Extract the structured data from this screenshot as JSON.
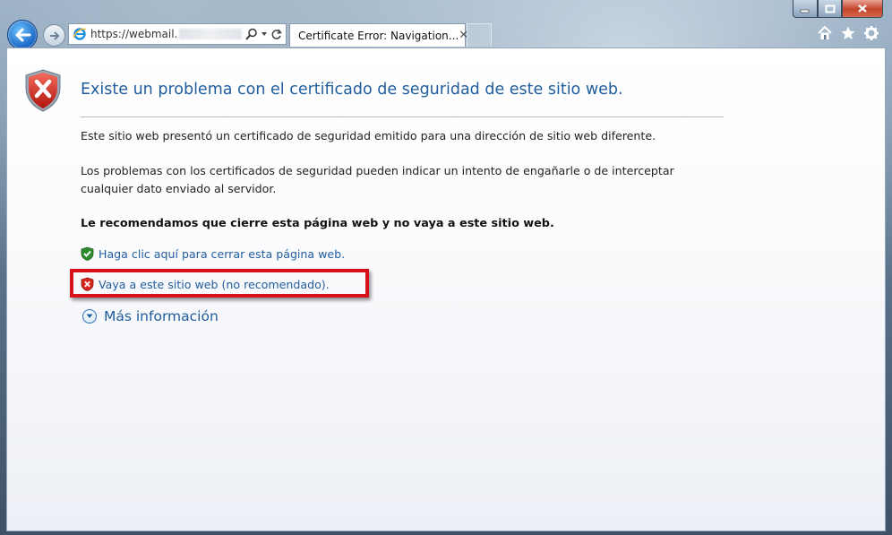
{
  "browser": {
    "address_url": "https://webmail.",
    "tab_title": "Certificate Error: Navigation...",
    "tab_close": "✕"
  },
  "icons": {
    "back": "back-arrow-icon",
    "forward": "forward-arrow-icon",
    "ie": "internet-explorer-icon",
    "search": "search-icon",
    "refresh": "refresh-icon",
    "home": "home-icon",
    "favorites": "star-icon",
    "tools": "gear-icon",
    "error_shield": "error-shield-icon",
    "safe_shield": "green-shield-icon",
    "expand": "chevron-down-circle-icon"
  },
  "page": {
    "title": "Existe un problema con el certificado de seguridad de este sitio web.",
    "paragraph1": "Este sitio web presentó un certificado de seguridad emitido para una dirección de sitio web diferente.",
    "paragraph2": "Los problemas con los certificados de seguridad pueden indicar un intento de engañarle o de interceptar cualquier dato enviado al servidor.",
    "recommendation": "Le recomendamos que cierre esta página web y no vaya a este sitio web.",
    "close_link": "Haga clic aquí para cerrar esta página web.",
    "continue_link": "Vaya a este sitio web (no recomendado).",
    "more_info": "Más información"
  },
  "colors": {
    "link": "#1f5d9e",
    "highlight_box": "#d5121b",
    "error_red": "#d6241d",
    "safe_green": "#2e8b2e"
  }
}
